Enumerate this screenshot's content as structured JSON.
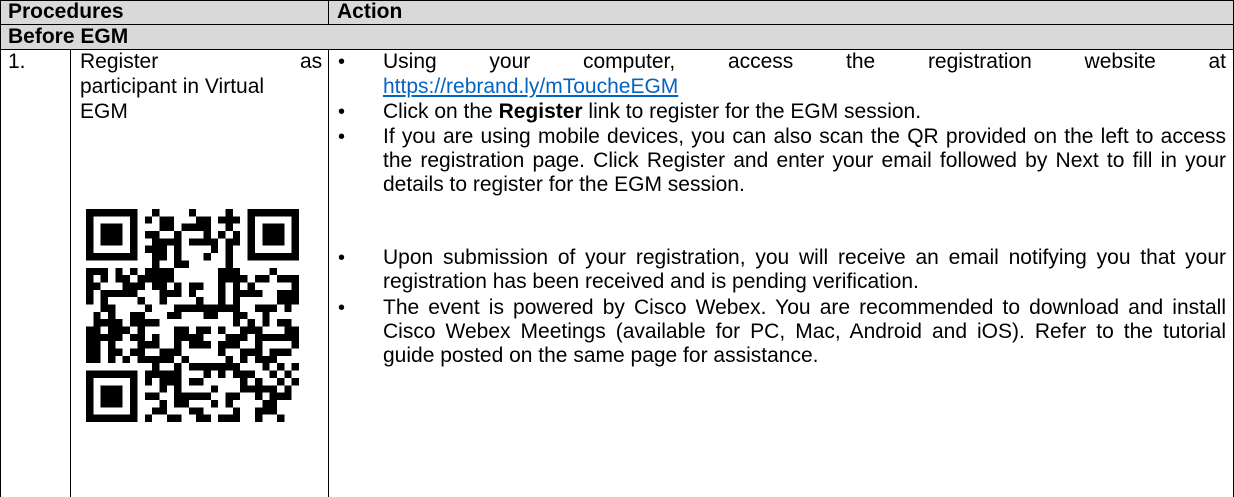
{
  "table": {
    "headers": {
      "procedures": "Procedures",
      "action": "Action"
    },
    "section_title": "Before EGM",
    "rows": [
      {
        "number": "1.",
        "procedure_line1_word1": "Register",
        "procedure_line1_word2": "as",
        "procedure_line2": "participant in Virtual",
        "procedure_line3": "EGM",
        "qr_code": "qr-code-image",
        "actions": [
          {
            "line1_words": [
              "Using",
              "your",
              "computer,",
              "access",
              "the",
              "registration",
              "website",
              "at"
            ],
            "link": "https://rebrand.ly/mToucheEGM"
          },
          {
            "before": "Click on the ",
            "bold": "Register",
            "after": " link to register for the EGM session."
          },
          {
            "text": "If you are using mobile devices, you can also scan the QR provided on the left to access the registration page. Click Register and enter your email followed by Next to fill in your details to register for the EGM session."
          },
          {
            "text": "Upon submission of your registration, you will receive an email notifying you that your registration has been received and is pending verification."
          },
          {
            "text": "The event is powered by Cisco Webex. You are recommended to download and install Cisco Webex Meetings (available for PC, Mac, Android and iOS). Refer to the tutorial guide posted on the same page for assistance."
          }
        ]
      }
    ]
  },
  "bullet_char": "•",
  "colors": {
    "header_bg": "#d9d9d9",
    "link": "#0563c1",
    "border": "#000000"
  }
}
